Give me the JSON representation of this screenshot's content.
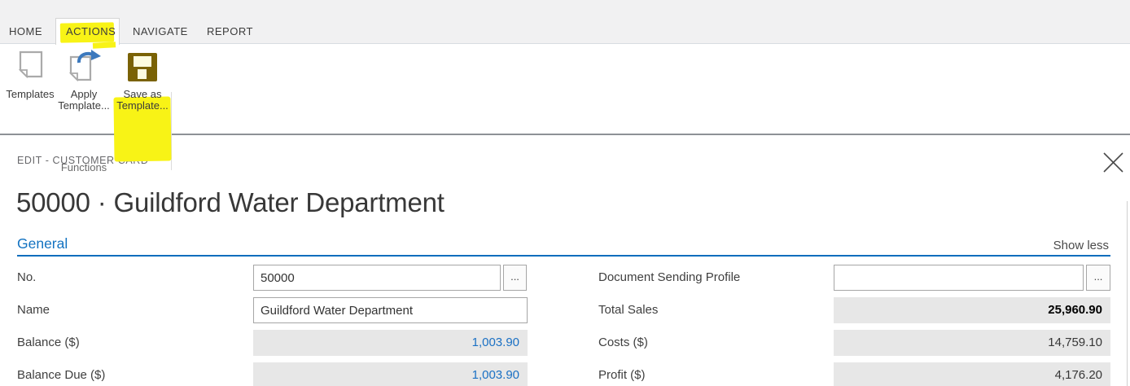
{
  "ribbon": {
    "tabs": [
      {
        "label": "HOME",
        "active": false
      },
      {
        "label": "ACTIONS",
        "active": true,
        "highlighted": true
      },
      {
        "label": "NAVIGATE",
        "active": false
      },
      {
        "label": "REPORT",
        "active": false
      }
    ],
    "group_label": "Functions",
    "buttons": [
      {
        "line1": "Templates",
        "line2": "",
        "icon": "page-icon"
      },
      {
        "line1": "Apply",
        "line2": "Template...",
        "icon": "page-arrow-icon"
      },
      {
        "line1": "Save as",
        "line2": "Template...",
        "icon": "floppy-disk-icon",
        "highlighted": true
      }
    ]
  },
  "dialog": {
    "mode_header": "EDIT - CUSTOMER CARD",
    "title": "50000 · Guildford Water Department",
    "section_title": "General",
    "show_toggle": "Show less"
  },
  "form": {
    "ellipsis": "...",
    "left": [
      {
        "label": "No.",
        "value": "50000"
      },
      {
        "label": "Name",
        "value": "Guildford Water Department"
      },
      {
        "label": "Balance ($)",
        "value": "1,003.90"
      },
      {
        "label": "Balance Due ($)",
        "value": "1,003.90"
      }
    ],
    "right": [
      {
        "label": "Document Sending Profile",
        "value": ""
      },
      {
        "label": "Total Sales",
        "value": "25,960.90"
      },
      {
        "label": "Costs ($)",
        "value": "14,759.10"
      },
      {
        "label": "Profit ($)",
        "value": "4,176.20"
      }
    ]
  },
  "colors": {
    "accent_blue": "#1272c1",
    "link_blue": "#1a70c4",
    "highlight_yellow": "#f8f316",
    "floppy_brown": "#7a6205",
    "arrow_blue": "#3c79bd",
    "readonly_bg": "#e7e7e7"
  }
}
